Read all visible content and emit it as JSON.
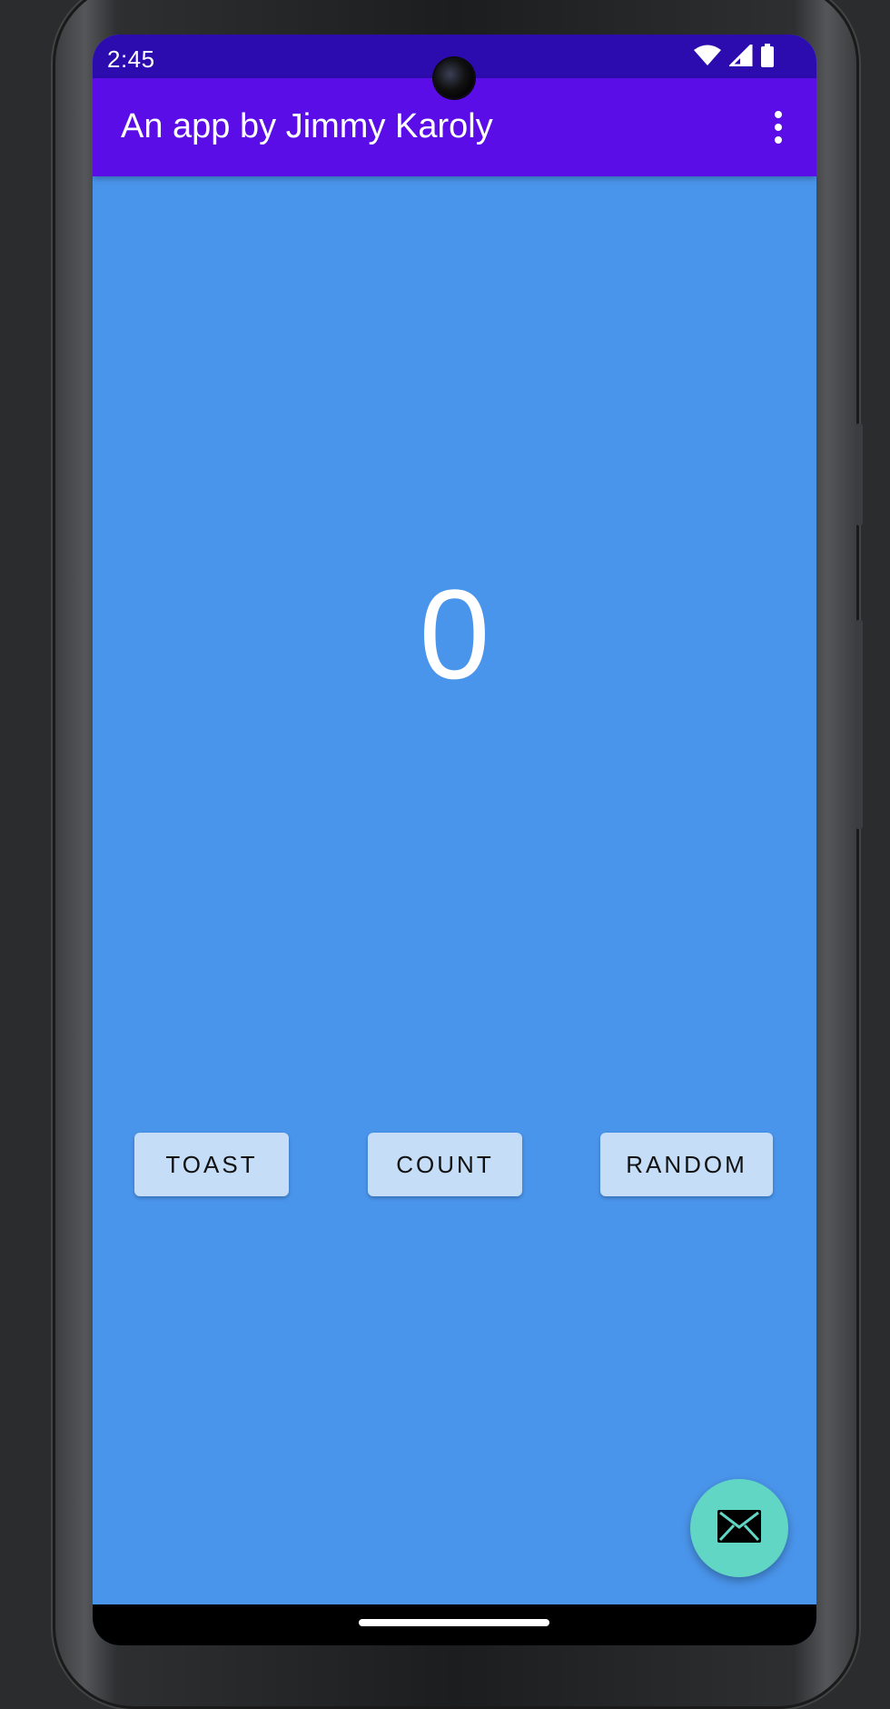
{
  "status_bar": {
    "time": "2:45",
    "icons": [
      "wifi-icon",
      "signal-icon",
      "battery-icon"
    ]
  },
  "app_bar": {
    "title": "An app by Jimmy Karoly",
    "overflow_icon": "more-vert-icon"
  },
  "main": {
    "count_value": "0",
    "buttons": {
      "toast": "TOAST",
      "count": "COUNT",
      "random": "RANDOM"
    }
  },
  "fab": {
    "icon": "mail-icon"
  },
  "colors": {
    "status_bar": "#2c0cae",
    "app_bar": "#5a0de6",
    "background": "#4a95ec",
    "button": "#c5ddf7",
    "fab": "#62d6c5"
  }
}
